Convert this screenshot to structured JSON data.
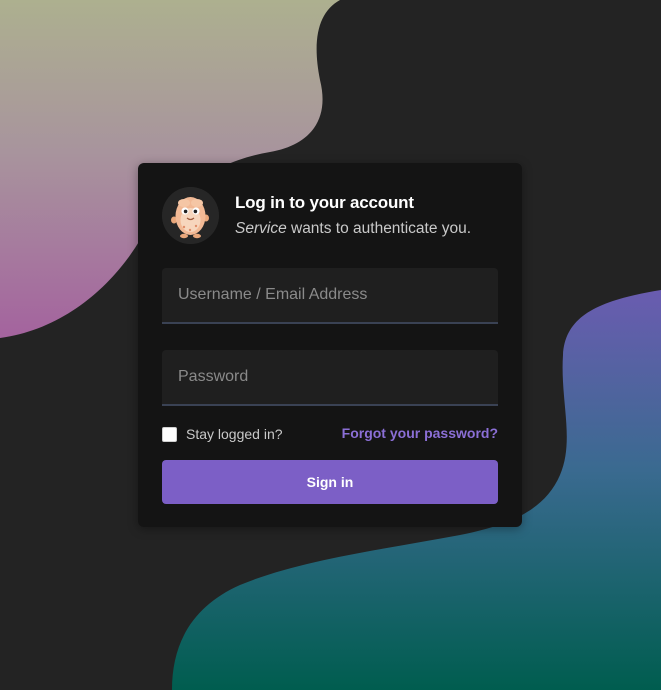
{
  "colors": {
    "page_background": "#232323",
    "card_background": "#141414",
    "accent": "#7c5fc6",
    "link": "#8b6fd6",
    "blob_top_left_top": "#adb08f",
    "blob_top_left_bottom": "#a66a9a",
    "blob_right_top": "#6a5cb0",
    "blob_right_bottom": "#006050"
  },
  "header": {
    "avatar_icon": "mascot-bean-icon",
    "title": "Log in to your account",
    "service_name": "Service",
    "subtitle_rest": " wants to authenticate you."
  },
  "form": {
    "username_placeholder": "Username / Email Address",
    "username_value": "",
    "password_placeholder": "Password",
    "password_value": "",
    "remember_label": "Stay logged in?",
    "remember_checked": false,
    "forgot_label": "Forgot your password?",
    "submit_label": "Sign in"
  }
}
